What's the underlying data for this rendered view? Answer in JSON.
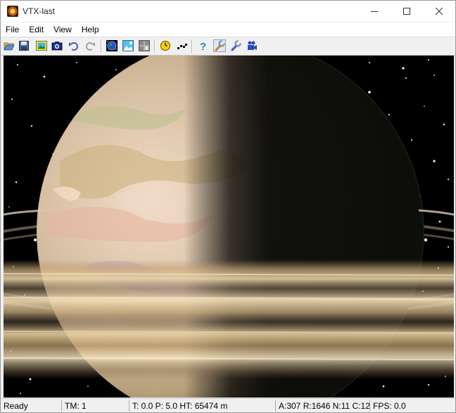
{
  "window": {
    "title": "VTX-last",
    "app_icon": "planet-app-icon",
    "controls": [
      "minimize-icon",
      "maximize-icon",
      "close-icon"
    ]
  },
  "menu": {
    "items": [
      "File",
      "Edit",
      "View",
      "Help"
    ]
  },
  "toolbar": {
    "buttons": [
      "open-folder-icon",
      "save-icon",
      "image-icon",
      "camera-icon",
      "undo-icon",
      "redo-icon",
      "globe-icon",
      "terrain-image-icon",
      "grid-image-icon",
      "clock-icon",
      "path-icon",
      "help-icon",
      "wrench-icon",
      "wrench-alt-icon",
      "video-camera-icon"
    ],
    "pressed": "wrench-icon"
  },
  "viewport": {
    "scene": "ringed planet in starfield"
  },
  "status": {
    "ready": "Ready",
    "tm": "TM: 1",
    "position": "T: 0.0 P: 5.0 HT: 65474 m",
    "counts": "A:307 R:1646 N:11 C:12",
    "fps": "FPS: 0.0"
  }
}
